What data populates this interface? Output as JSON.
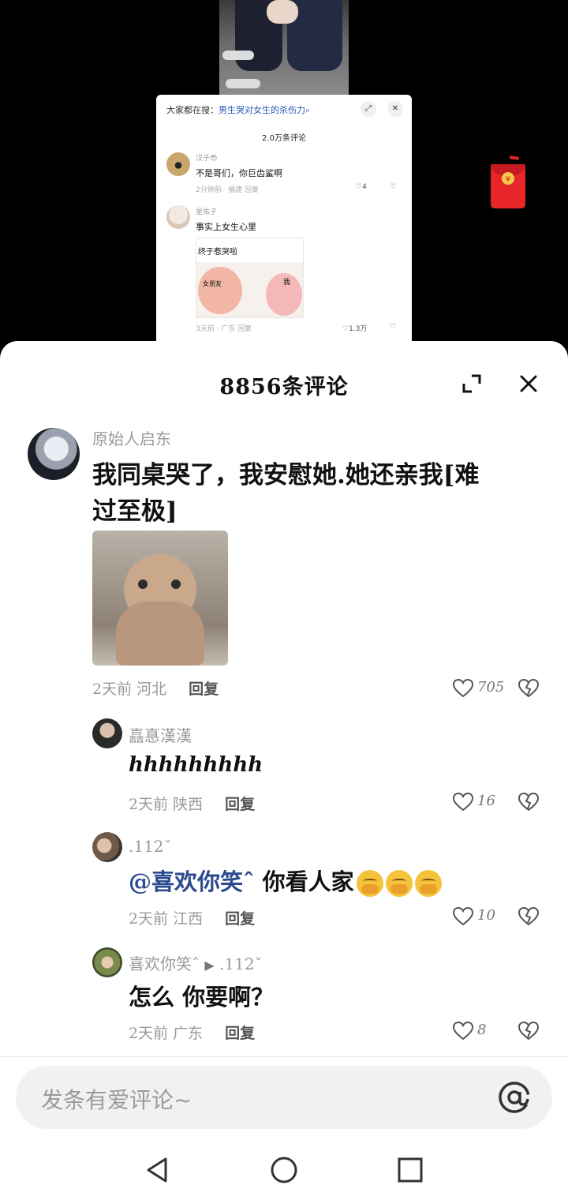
{
  "mini_card": {
    "search_prefix": "大家都在搜：",
    "search_query": "男生哭对女生的杀伤力",
    "search_icon_glyph": "⌕",
    "comment_count": "2.0万条评论",
    "comments": [
      {
        "name": "汉子😎",
        "text": "不是哥们，你巨齿鲨啊",
        "meta": "2分钟前 · 福建    回复",
        "likes": "4"
      },
      {
        "name": "星佑子",
        "text": "事实上女生心里",
        "meta": "3天前 · 广东    回复",
        "likes": "1.3万",
        "sticker": {
          "caption": "终于惹哭啦",
          "label_left": "女朋友",
          "label_right": "我"
        }
      }
    ]
  },
  "sheet": {
    "title": "8856条评论",
    "comments": [
      {
        "name": "原始人启东",
        "text_line1": "我同桌哭了，我安慰她.她还亲我[难",
        "text_line2": "过至极]",
        "time": "2天前",
        "location": "河北",
        "reply_label": "回复",
        "likes": "705"
      },
      {
        "name": "嚞惪漢漢",
        "text": "hhhhhhhhh",
        "time": "2天前",
        "location": "陕西",
        "reply_label": "回复",
        "likes": "16"
      },
      {
        "name": ".112ˇ",
        "mention": "@喜欢你笑ˆ",
        "text": " 你看人家",
        "time": "2天前",
        "location": "江西",
        "reply_label": "回复",
        "likes": "10"
      },
      {
        "name": "喜欢你笑ˆ",
        "arrow": "▶",
        "reply_to": ".112ˇ",
        "text": "怎么 你要啊？",
        "time": "2天前",
        "location": "广东",
        "reply_label": "回复",
        "likes": "8"
      }
    ],
    "input_placeholder": "发条有爱评论~"
  },
  "colors": {
    "accent_mention": "#2b4a8e",
    "red_packet": "#e8262a",
    "muted": "#9a9a9a"
  }
}
